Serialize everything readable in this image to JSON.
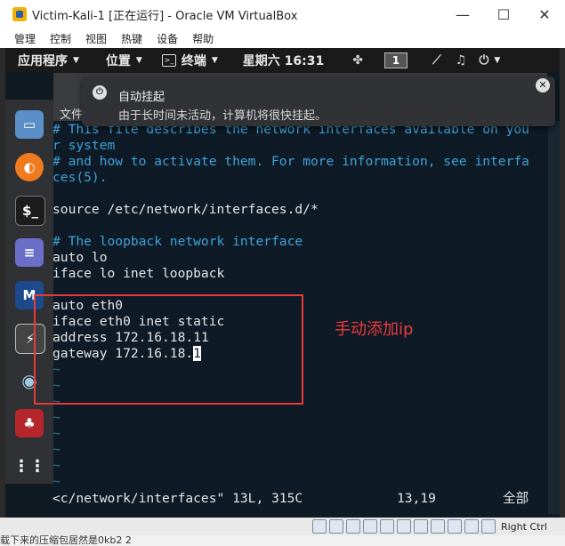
{
  "window": {
    "title": "Victim-Kali-1 [正在运行] - Oracle VM VirtualBox",
    "minimize": "—",
    "maximize": "☐",
    "close": "✕"
  },
  "menubar": [
    "管理",
    "控制",
    "视图",
    "热键",
    "设备",
    "帮助"
  ],
  "kali_panel": {
    "applications": "应用程序",
    "places": "位置",
    "terminal": "终端",
    "datetime": "星期六 16:31",
    "workspace": "1"
  },
  "notification": {
    "title": "自动挂起",
    "body": "由于长时间未活动，计算机将很快挂起。"
  },
  "terminal": {
    "file_menu": "文件",
    "lines": [
      {
        "text": "# This file describes the network interfaces available on you",
        "type": "comment"
      },
      {
        "text": "r system",
        "type": "comment"
      },
      {
        "text": "# and how to activate them. For more information, see interfa",
        "type": "comment"
      },
      {
        "text": "ces(5).",
        "type": "comment"
      },
      {
        "text": "",
        "type": "normal"
      },
      {
        "text": "source /etc/network/interfaces.d/*",
        "type": "normal"
      },
      {
        "text": "",
        "type": "normal"
      },
      {
        "text": "# The loopback network interface",
        "type": "comment"
      },
      {
        "text": "auto lo",
        "type": "normal"
      },
      {
        "text": "iface lo inet loopback",
        "type": "normal"
      },
      {
        "text": "",
        "type": "normal"
      },
      {
        "text": "auto eth0",
        "type": "normal"
      },
      {
        "text": "iface eth0 inet static",
        "type": "normal"
      },
      {
        "text": "address 172.16.18.11",
        "type": "normal"
      },
      {
        "text": "gateway 172.16.18.1",
        "type": "cursor"
      },
      {
        "text": "~",
        "type": "tilde"
      },
      {
        "text": "~",
        "type": "tilde"
      },
      {
        "text": "~",
        "type": "tilde"
      },
      {
        "text": "~",
        "type": "tilde"
      },
      {
        "text": "~",
        "type": "tilde"
      },
      {
        "text": "~",
        "type": "tilde"
      },
      {
        "text": "~",
        "type": "tilde"
      },
      {
        "text": "~",
        "type": "tilde"
      }
    ],
    "status_file": "<c/network/interfaces\" 13L, 315C",
    "status_pos": "13,19",
    "status_all": "全部"
  },
  "annotation": "手动添加ip",
  "statusbar": {
    "host_key": "Right Ctrl"
  },
  "host_bottom_text": "载下来的压缩包居然是0kb2 2"
}
